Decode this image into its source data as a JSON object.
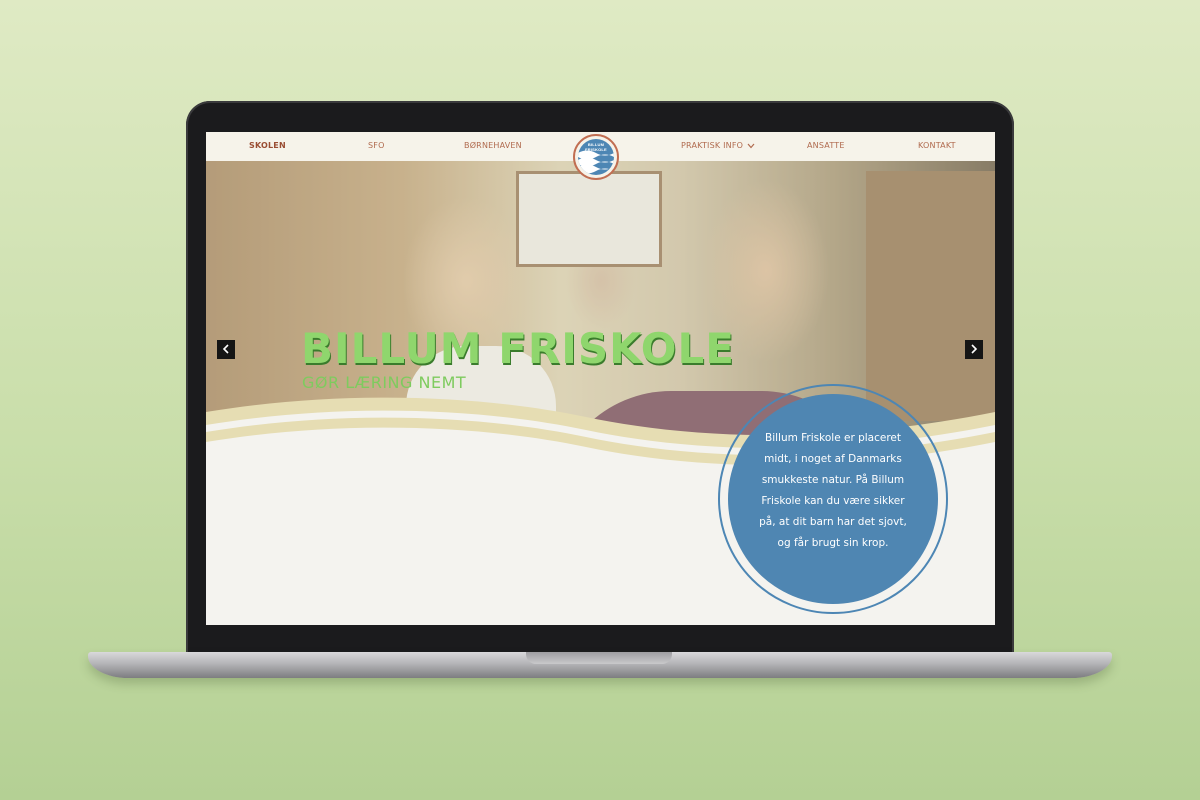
{
  "nav": {
    "items": [
      {
        "label": "SKOLEN"
      },
      {
        "label": "SFO"
      },
      {
        "label": "BØRNEHAVEN"
      },
      {
        "label": "PRAKTISK INFO"
      },
      {
        "label": "ANSATTE"
      },
      {
        "label": "KONTAKT"
      }
    ],
    "logo_text": "BILLUM FRISKOLE"
  },
  "hero": {
    "title": "BILLUM FRISKOLE",
    "subtitle": "GØR LÆRING NEMT"
  },
  "intro": {
    "text": "Billum Friskole er placeret midt, i noget af Danmarks smukkeste natur. På Billum Friskole kan du være sikker på, at dit barn har det sjovt, og får brugt sin krop."
  },
  "colors": {
    "nav_text": "#b06a4e",
    "hero_title": "#8fd66d",
    "circle": "#4f86b2",
    "wave": "#e6ddb3"
  },
  "icons": {
    "prev": "chevron-left-icon",
    "next": "chevron-right-icon",
    "dropdown": "chevron-down-icon"
  }
}
